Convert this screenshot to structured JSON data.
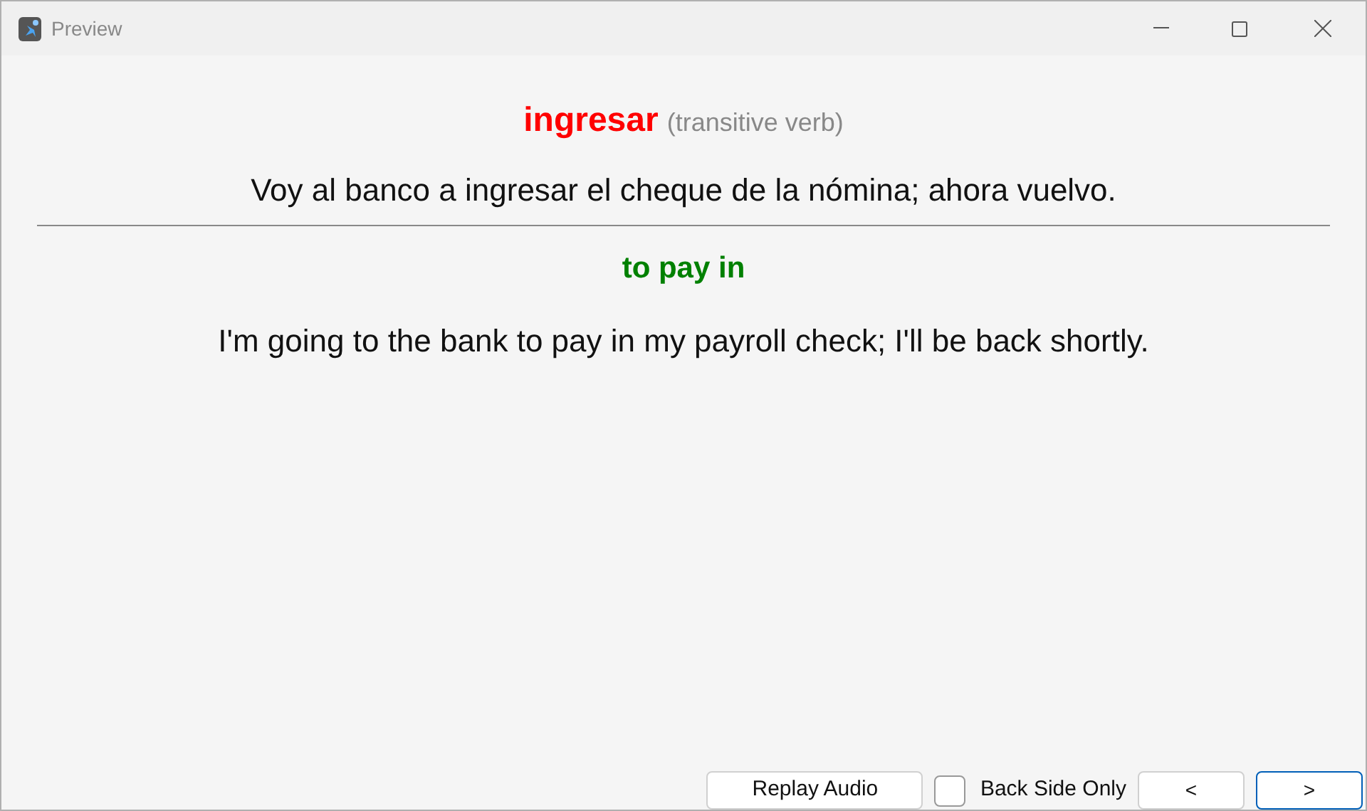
{
  "window": {
    "title": "Preview"
  },
  "front": {
    "word": "ingresar",
    "part_of_speech": "(transitive verb)",
    "sentence": "Voy al banco a ingresar el cheque de la nómina; ahora vuelvo."
  },
  "back": {
    "word": "to pay in",
    "sentence": "I'm going to the bank to pay in my payroll check; I'll be back shortly."
  },
  "replay_button": "Replay Audio",
  "back_side_only": {
    "label": "Back Side Only",
    "checked": false
  },
  "nav_buttons": [
    {
      "label": "<",
      "focused": false
    },
    {
      "label": ">",
      "focused": true
    }
  ]
}
